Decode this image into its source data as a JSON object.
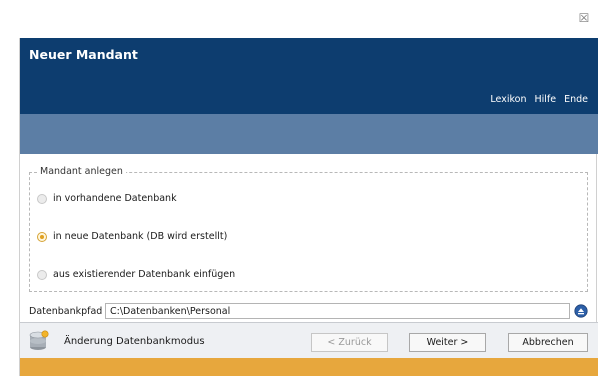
{
  "window": {
    "close_glyph": "☒"
  },
  "header": {
    "title": "Neuer Mandant",
    "nav": [
      "Lexikon",
      "Hilfe",
      "Ende"
    ]
  },
  "group": {
    "legend": "Mandant anlegen",
    "options": [
      {
        "label": "in vorhandene Datenbank",
        "selected": false
      },
      {
        "label": "in neue Datenbank (DB wird erstellt)",
        "selected": true
      },
      {
        "label": "aus existierender Datenbank einfügen",
        "selected": false
      }
    ]
  },
  "path": {
    "label": "Datenbankpfad",
    "value": "C:\\Datenbanken\\Personal"
  },
  "footer": {
    "mode_label": "Änderung Datenbankmodus",
    "back_label": "< Zurück",
    "next_label": "Weiter >",
    "cancel_label": "Abbrechen",
    "back_enabled": false
  },
  "colors": {
    "header": "#0d3d6f",
    "subbar": "#5c7ea5",
    "accent": "#e7a73d"
  }
}
